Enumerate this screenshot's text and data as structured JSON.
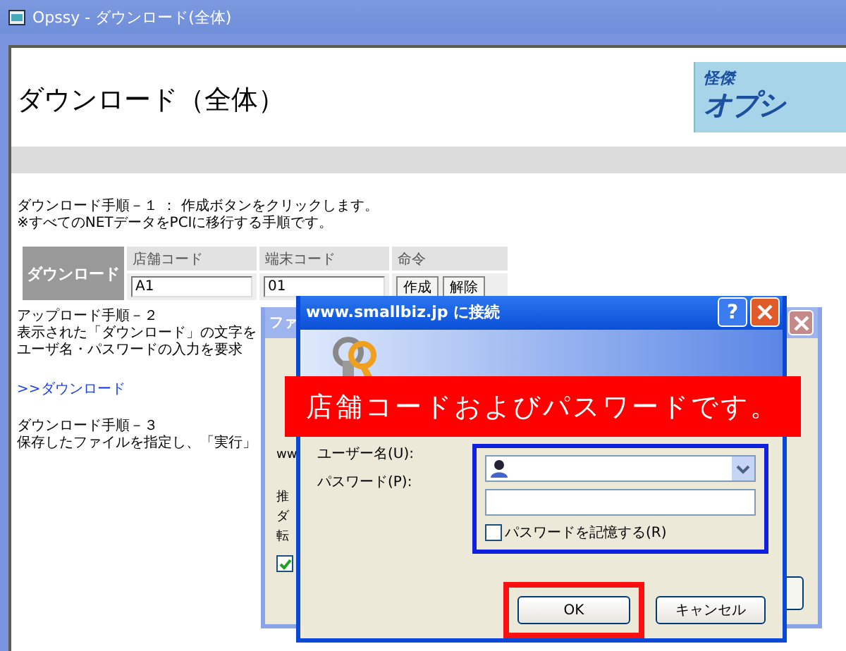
{
  "window": {
    "title": "Opssy - ダウンロード(全体)"
  },
  "page": {
    "heading": "ダウンロード（全体）",
    "logo": {
      "top": "怪傑",
      "main": "オプシ"
    },
    "intro": [
      "ダウンロード手順－１ ： 作成ボタンをクリックします。",
      "※すべてのNETデータをPCIに移行する手順です。"
    ],
    "download_table": {
      "row_header": "ダウンロード",
      "columns": [
        "店舗コード",
        "端末コード",
        "命令"
      ],
      "store_code": "A1",
      "terminal_code": "01",
      "buttons": [
        "作成",
        "解除"
      ]
    },
    "step2": [
      "アップロード手順－２",
      "表示された「ダウンロード」の文字を",
      "ユーザ名・パスワードの入力を要求"
    ],
    "link": ">>ダウンロード",
    "step3": [
      "ダウンロード手順－３",
      "保存したファイルを指定し、「実行」"
    ]
  },
  "back_dialog": {
    "title": "ファ",
    "fragments": [
      "ww",
      "推",
      "ダ",
      "転"
    ],
    "checked": true
  },
  "login_dialog": {
    "title": "www.smallbiz.jp に接続",
    "help": "?",
    "user_label": "ユーザー名(U):",
    "password_label": "パスワード(P):",
    "remember": {
      "label": "パスワードを記憶する(R)",
      "checked": false
    },
    "buttons": [
      {
        "label": "OK",
        "highlighted": true
      },
      {
        "label": "キャンセル",
        "highlighted": false
      }
    ]
  },
  "callout": "店舗コードおよびパスワードです。"
}
